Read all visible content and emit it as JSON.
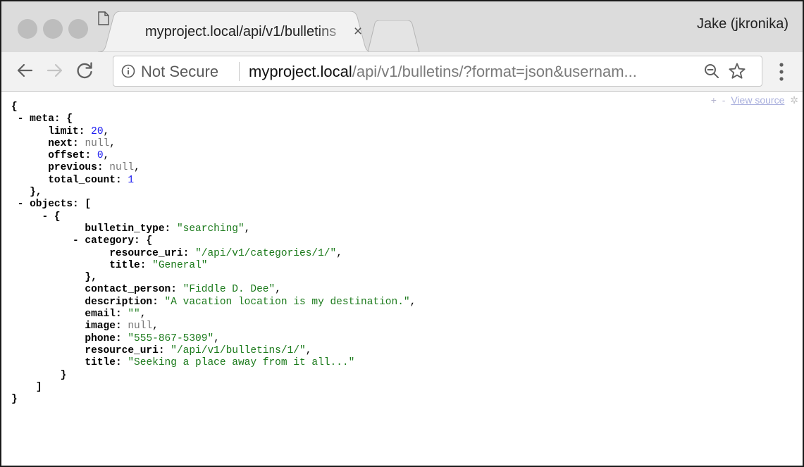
{
  "browser": {
    "tab": {
      "title": "myproject.local/api/v1/bulletins",
      "close": "×"
    },
    "profile_name": "Jake (jkronika)",
    "omnibox": {
      "security_label": "Not Secure",
      "url_host": "myproject.local",
      "url_rest": "/api/v1/bulletins/?format=json&usernam..."
    },
    "icons": {
      "back": "back-arrow-icon",
      "forward": "forward-arrow-icon",
      "reload": "reload-icon",
      "info": "info-icon",
      "zoom": "zoom-out-icon",
      "star": "bookmark-star-icon",
      "menu": "kebab-menu-icon"
    }
  },
  "viewer": {
    "expand": "+",
    "collapse": "-",
    "view_source": "View source",
    "gear": "✲"
  },
  "json": {
    "open": "{",
    "close": "}",
    "meta": {
      "key": "meta",
      "limit": 20,
      "next": "null",
      "offset": 0,
      "previous": "null",
      "total_count": 1
    },
    "objects_key": "objects",
    "object": {
      "bulletin_type": "\"searching\"",
      "category_key": "category",
      "category": {
        "resource_uri": "\"/api/v1/categories/1/\"",
        "title": "\"General\""
      },
      "contact_person": "\"Fiddle D. Dee\"",
      "description": "\"A vacation location is my destination.\"",
      "email": "\"\"",
      "image": "null",
      "phone": "\"555-867-5309\"",
      "resource_uri": "\"/api/v1/bulletins/1/\"",
      "title": "\"Seeking a place away from it all...\""
    }
  },
  "colors": {
    "number": "#1a1af0",
    "string": "#1b7a1b",
    "null": "#777777",
    "key": "#000000"
  }
}
